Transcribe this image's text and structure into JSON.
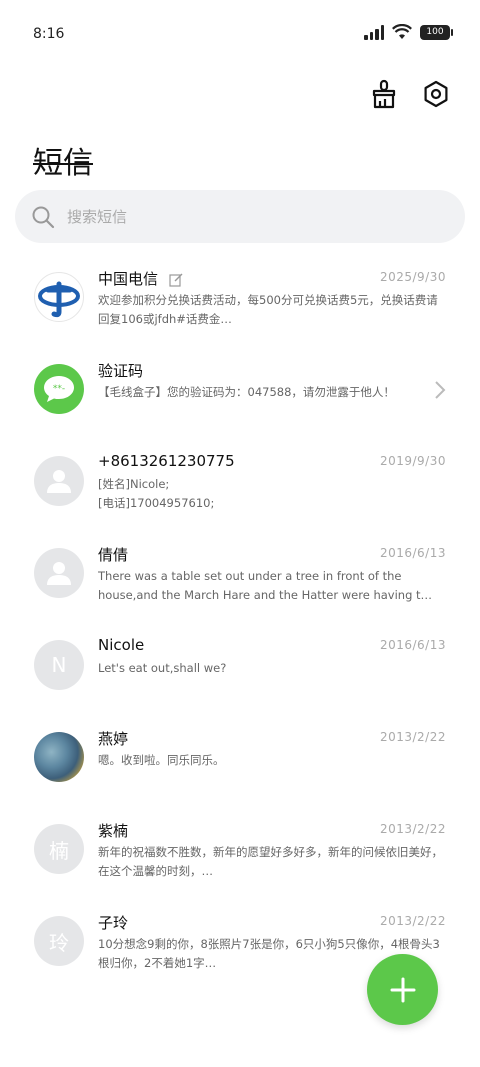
{
  "status": {
    "time": "8:16",
    "battery": "100"
  },
  "header": {
    "title": "短信"
  },
  "search": {
    "placeholder": "搜索短信"
  },
  "conversations": [
    {
      "name": "中国电信",
      "date": "2025/9/30",
      "preview": "欢迎参加积分兑换话费活动，每500分可兑换话费5元，兑换话费请回复106或jfdh#话费金…",
      "avatar": "china-telecom-logo"
    },
    {
      "name": "验证码",
      "date": "",
      "preview": "【毛线盒子】您的验证码为：047588，请勿泄露于他人！",
      "avatar": "chat-bubble"
    },
    {
      "name": "+8613261230775",
      "date": "2019/9/30",
      "preview": "[姓名]Nicole;\n[电话]17004957610;",
      "avatar": "person"
    },
    {
      "name": "倩倩",
      "date": "2016/6/13",
      "preview": "There was a table set out under a tree in front of the house,and the March Hare and the Hatter were having t…",
      "avatar": "person"
    },
    {
      "name": "Nicole",
      "date": "2016/6/13",
      "preview": "Let's eat out,shall we?",
      "avatar": "N"
    },
    {
      "name": "燕婷",
      "date": "2013/2/22",
      "preview": "嗯。收到啦。同乐同乐。",
      "avatar": "photo"
    },
    {
      "name": "紫楠",
      "date": "2013/2/22",
      "preview": "新年的祝福数不胜数，新年的愿望好多好多，新年的问候依旧美好，在这个温馨的时刻，…",
      "avatar": "楠"
    },
    {
      "name": "子玲",
      "date": "2013/2/22",
      "preview": "10分想念9剩的你，8张照片7张是你，6只小狗5只像你，4根骨头3根归你，2不着她1字…",
      "avatar": "玲"
    }
  ],
  "colors": {
    "accent": "#5cc84a",
    "telecom_blue": "#1f5fb0"
  }
}
